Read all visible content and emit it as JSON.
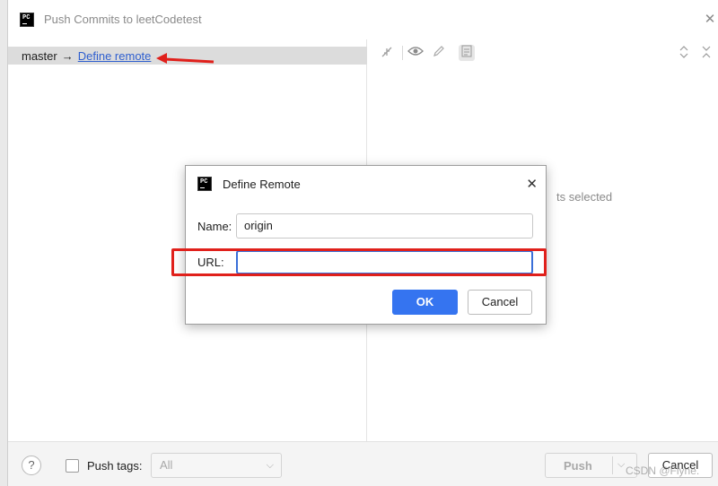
{
  "window": {
    "title": "Push Commits to leetCodetest",
    "icon_text": "PC"
  },
  "left_pane": {
    "local_branch": "master",
    "arrow": "→",
    "remote_link": "Define remote"
  },
  "right_pane": {
    "status_text": "ts selected"
  },
  "bottom_bar": {
    "help_label": "?",
    "push_tags_label": "Push tags:",
    "tags_select_value": "All",
    "push_label": "Push",
    "cancel_label": "Cancel",
    "watermark": "CSDN @Flyne."
  },
  "dialog": {
    "title": "Define Remote",
    "icon_text": "PC",
    "name_label": "Name:",
    "name_value": "origin",
    "url_label": "URL:",
    "url_value": "",
    "ok_label": "OK",
    "cancel_label": "Cancel"
  },
  "colors": {
    "accent": "#3574f0",
    "annotation_red": "#e0201b",
    "link": "#2f5fcf"
  }
}
